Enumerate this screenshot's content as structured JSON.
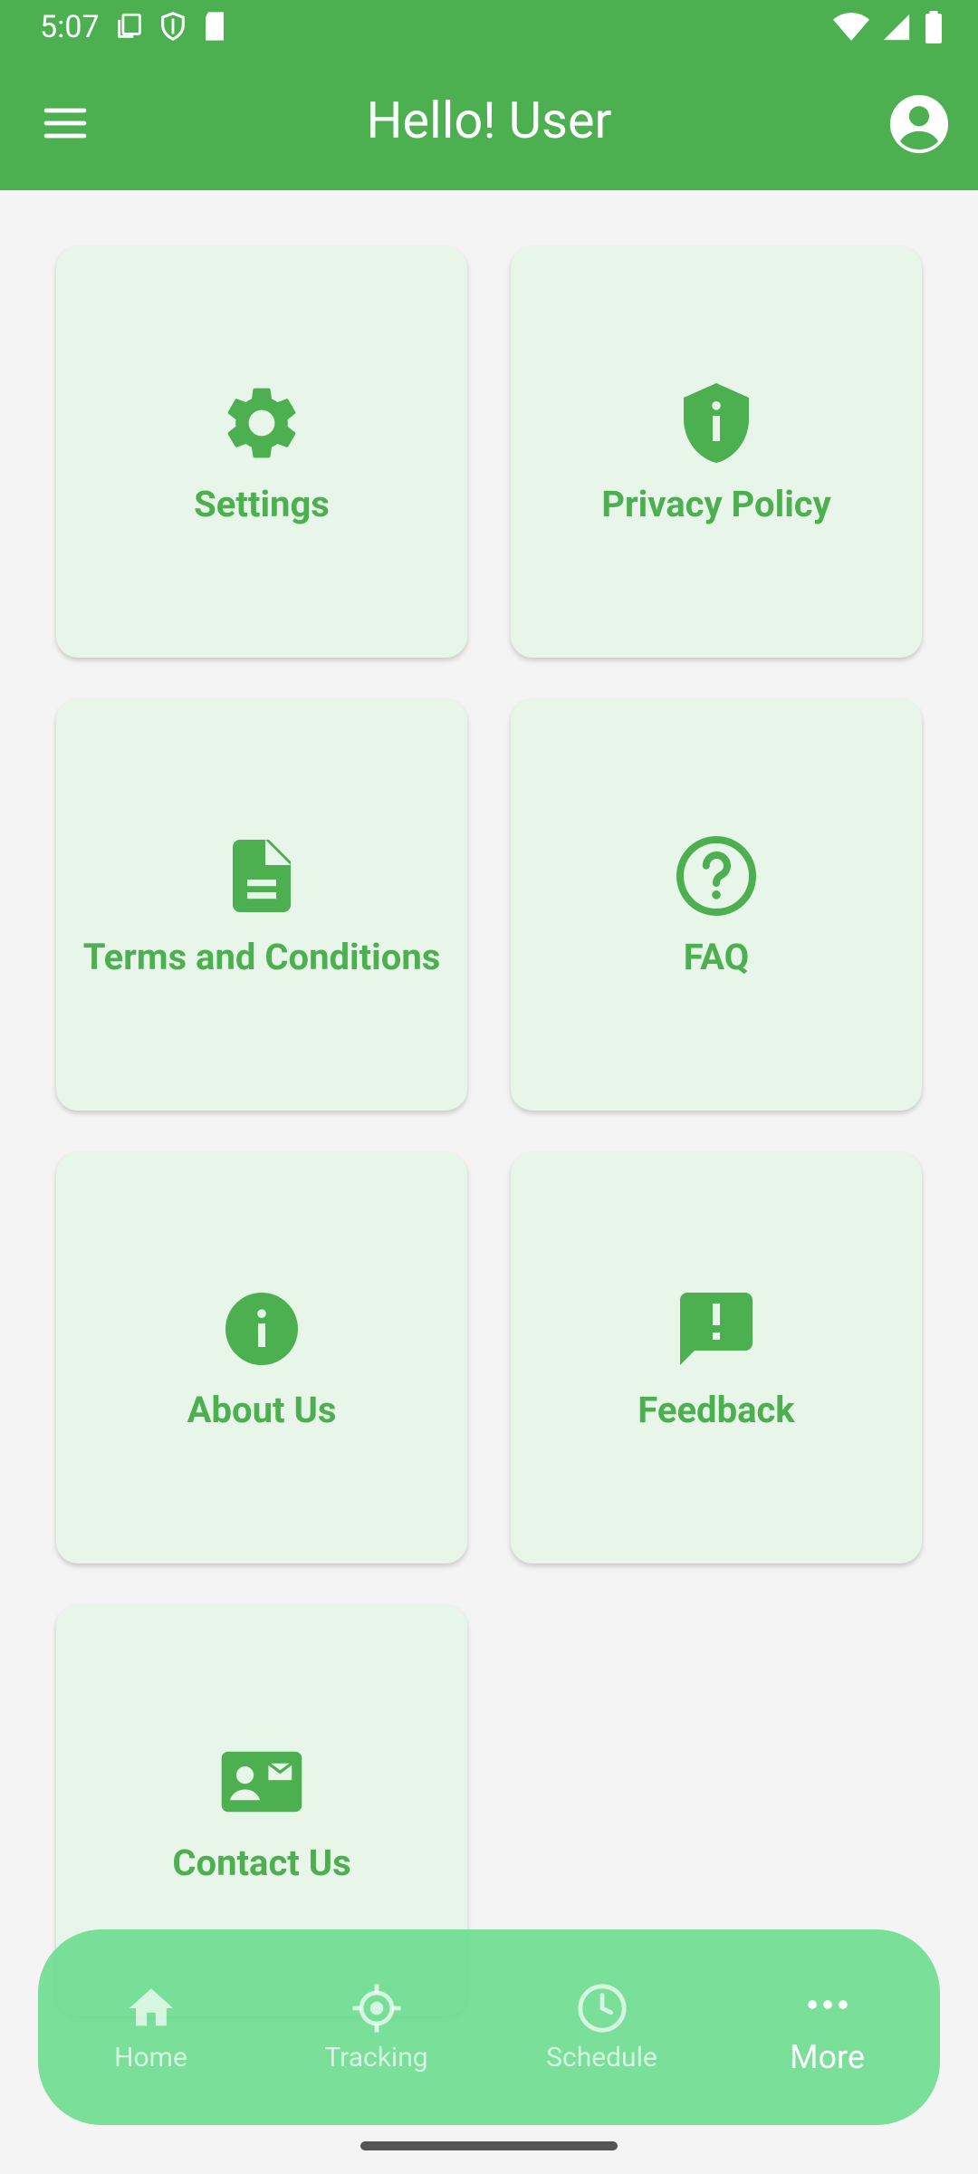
{
  "status": {
    "time": "5:07"
  },
  "app_bar": {
    "title": "Hello! User"
  },
  "menu_cards": [
    {
      "label": "Settings",
      "icon": "gear-icon"
    },
    {
      "label": "Privacy Policy",
      "icon": "shield-info-icon"
    },
    {
      "label": "Terms and Conditions",
      "icon": "document-icon"
    },
    {
      "label": "FAQ",
      "icon": "help-circle-icon"
    },
    {
      "label": "About Us",
      "icon": "info-icon"
    },
    {
      "label": "Feedback",
      "icon": "feedback-icon"
    },
    {
      "label": "Contact Us",
      "icon": "contact-card-icon"
    }
  ],
  "bottom_nav": {
    "items": [
      {
        "label": "Home",
        "icon": "home-icon"
      },
      {
        "label": "Tracking",
        "icon": "location-target-icon"
      },
      {
        "label": "Schedule",
        "icon": "clock-icon"
      },
      {
        "label": "More",
        "icon": "more-dots-icon",
        "active": true
      }
    ]
  },
  "colors": {
    "primary": "#4caf50",
    "card_bg": "#e8f5e9",
    "nav_bg": "#68dc8c"
  }
}
